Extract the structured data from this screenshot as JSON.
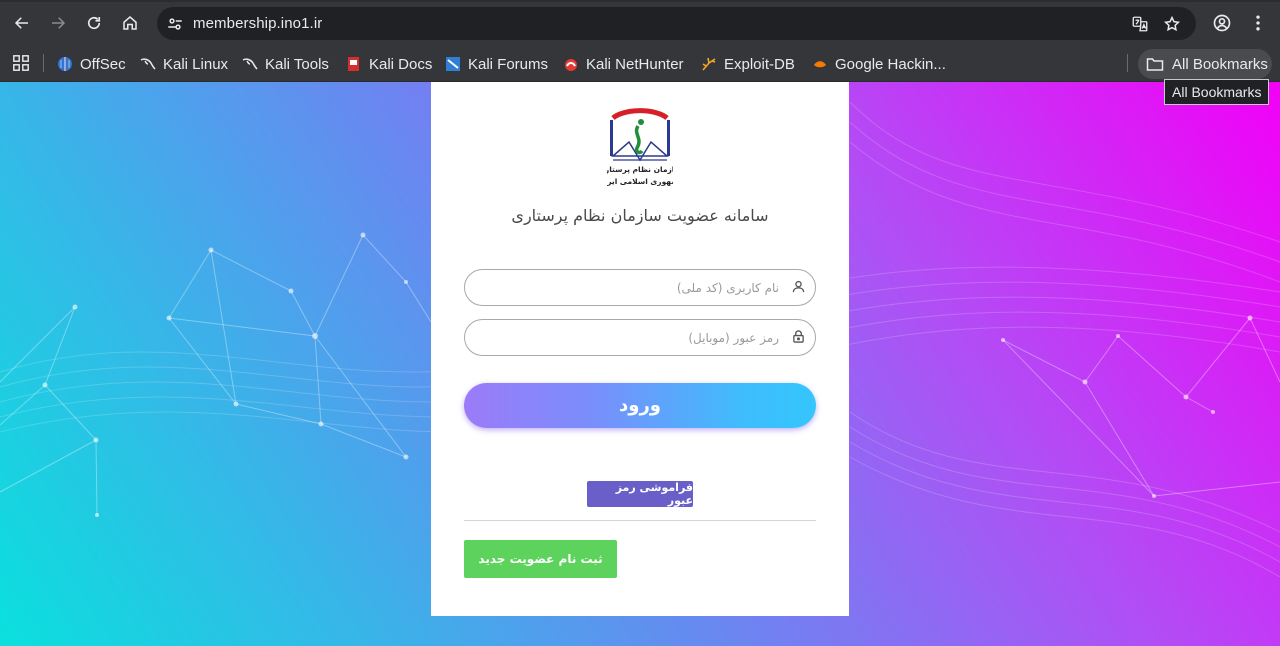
{
  "browser": {
    "url": "membership.ino1.ir",
    "bookmarks": [
      {
        "label": "OffSec",
        "icon": "offsec-icon"
      },
      {
        "label": "Kali Linux",
        "icon": "kali-dragon-icon"
      },
      {
        "label": "Kali Tools",
        "icon": "kali-dragon-icon"
      },
      {
        "label": "Kali Docs",
        "icon": "kali-docs-icon"
      },
      {
        "label": "Kali Forums",
        "icon": "kali-forums-icon"
      },
      {
        "label": "Kali NetHunter",
        "icon": "nethunter-icon"
      },
      {
        "label": "Exploit-DB",
        "icon": "exploit-db-icon"
      },
      {
        "label": "Google Hackin...",
        "icon": "ghdb-icon"
      }
    ],
    "all_bookmarks_label": "All Bookmarks",
    "tooltip": "All Bookmarks"
  },
  "page": {
    "logo_text_line1": "سازمان نظام پرستاری",
    "logo_text_line2": "جمهوری اسلامی ایران",
    "title": "سامانه عضویت سازمان نظام پرستاری",
    "username_placeholder": "نام کاربری (کد ملی)",
    "password_placeholder": "رمز عبور (موبایل)",
    "login_label": "ورود",
    "forgot_label": "فراموشی رمز عبور",
    "register_label": "ثبت نام عضویت جدید"
  },
  "colors": {
    "login_gradient_start": "#9c7bf8",
    "login_gradient_end": "#34c6fc",
    "forgot_button": "#6a5fc9",
    "register_button": "#5dd35d",
    "background_left": "#0ae0dd",
    "background_right": "#f200f7"
  }
}
